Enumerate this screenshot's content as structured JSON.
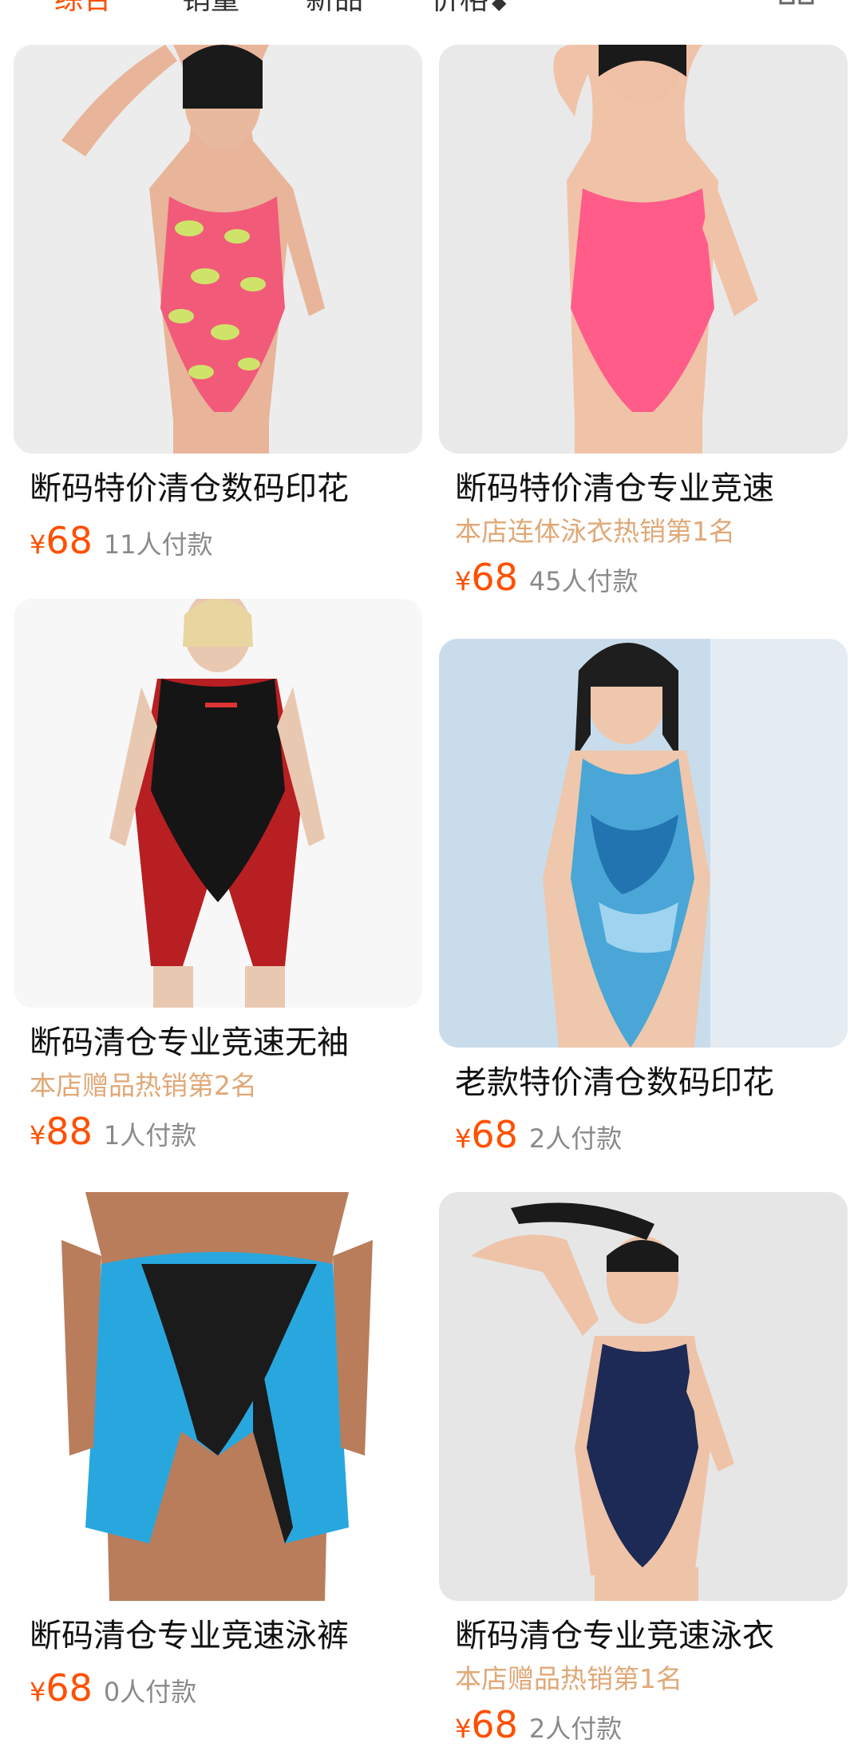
{
  "sort_bar": {
    "tabs": [
      {
        "label": "综合"
      },
      {
        "label": "销量"
      },
      {
        "label": "新品"
      },
      {
        "label": "价格"
      }
    ]
  },
  "colors": {
    "accent": "#ff5000",
    "rank_text": "#e0a877",
    "muted": "#8a8a8a"
  },
  "products": [
    {
      "title": "断码特价清仓数码印花",
      "price_symbol": "¥",
      "price": "68",
      "paid": "11人付款"
    },
    {
      "title": "断码特价清仓专业竞速",
      "rank": "本店连体泳衣热销第1名",
      "price_symbol": "¥",
      "price": "68",
      "paid": "45人付款"
    },
    {
      "title": "断码清仓专业竞速无袖",
      "rank": "本店赠品热销第2名",
      "price_symbol": "¥",
      "price": "88",
      "paid": "1人付款"
    },
    {
      "title": "老款特价清仓数码印花",
      "price_symbol": "¥",
      "price": "68",
      "paid": "2人付款"
    },
    {
      "title": "断码清仓专业竞速泳裤",
      "price_symbol": "¥",
      "price": "68",
      "paid": "0人付款"
    },
    {
      "title": "断码清仓专业竞速泳衣",
      "rank": "本店赠品热销第1名",
      "price_symbol": "¥",
      "price": "68",
      "paid": "2人付款"
    }
  ]
}
